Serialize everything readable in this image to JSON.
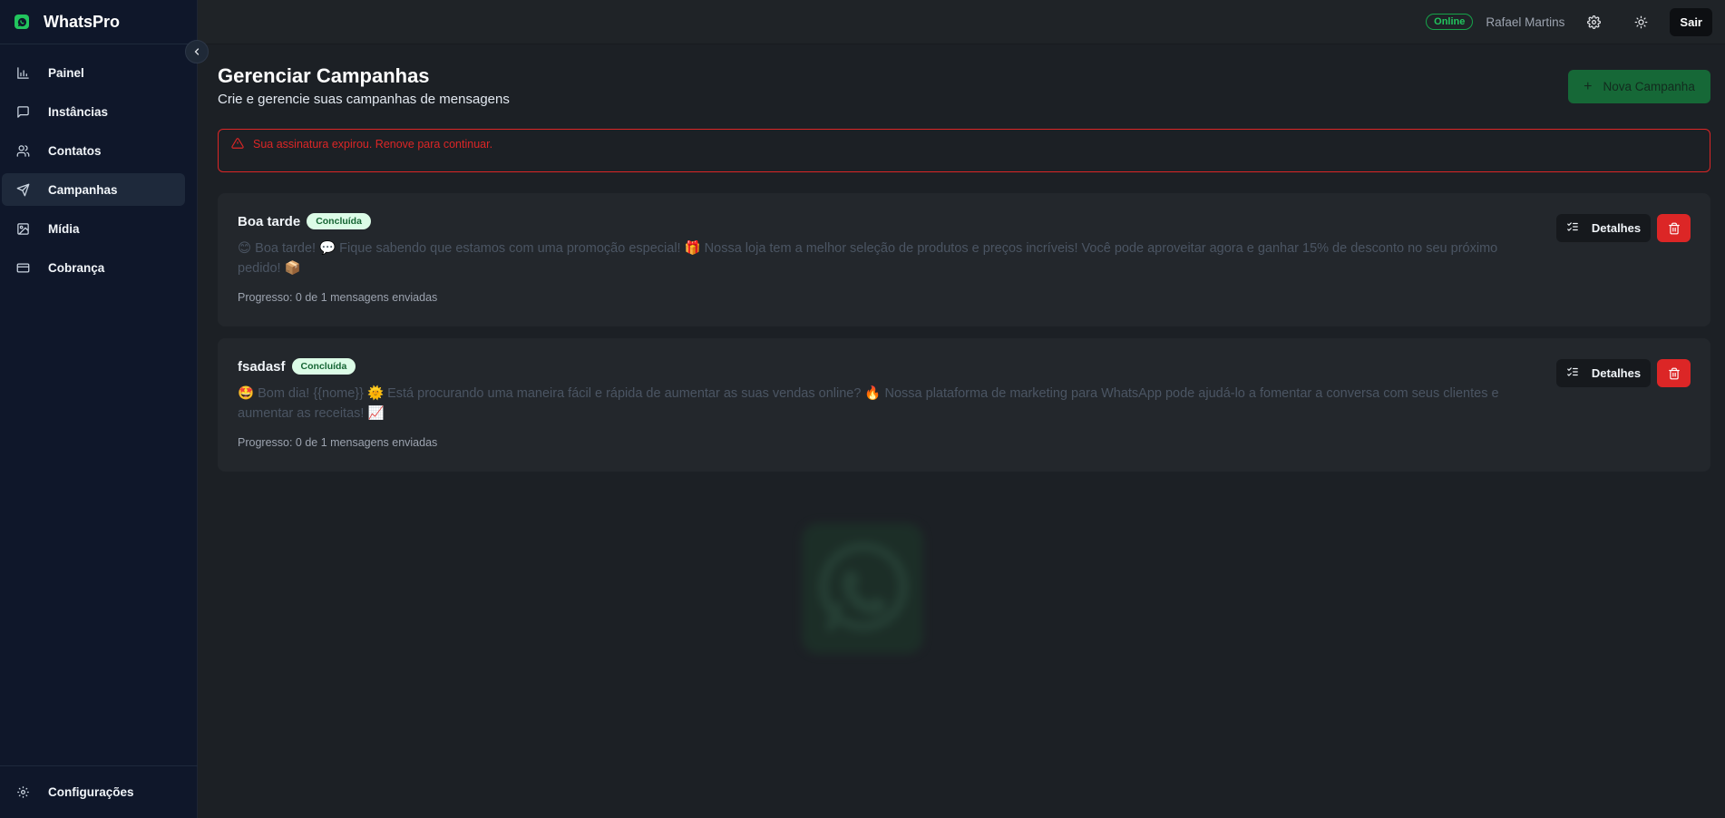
{
  "app": {
    "name": "WhatsPro",
    "logo_icon": "whatsapp-logo-icon"
  },
  "sidebar": {
    "items": [
      {
        "label": "Painel",
        "icon": "bar-chart-icon",
        "active": false
      },
      {
        "label": "Instâncias",
        "icon": "message-square-icon",
        "active": false
      },
      {
        "label": "Contatos",
        "icon": "users-icon",
        "active": false
      },
      {
        "label": "Campanhas",
        "icon": "send-icon",
        "active": true
      },
      {
        "label": "Mídia",
        "icon": "image-icon",
        "active": false
      },
      {
        "label": "Cobrança",
        "icon": "credit-card-icon",
        "active": false
      }
    ],
    "bottom_item": {
      "label": "Configurações",
      "icon": "settings-icon"
    }
  },
  "header": {
    "status": "Online",
    "user_name": "Rafael Martins",
    "logout_label": "Sair"
  },
  "page": {
    "title": "Gerenciar Campanhas",
    "subtitle": "Crie e gerencie suas campanhas de mensagens",
    "new_button_label": "Nova Campanha",
    "alert": "Sua assinatura expirou. Renove para continuar."
  },
  "campaigns": [
    {
      "name": "Boa tarde",
      "status": "Concluída",
      "message": "😊 Boa tarde! 💬 Fique sabendo que estamos com uma promoção especial! 🎁 Nossa loja tem a melhor seleção de produtos e preços incríveis! Você pode aproveitar agora e ganhar 15% de desconto no seu próximo pedido! 📦",
      "progress": "Progresso: 0 de 1 mensagens enviadas",
      "details_label": "Detalhes"
    },
    {
      "name": "fsadasf",
      "status": "Concluída",
      "message": "🤩 Bom dia! {{nome}} 🌞 Está procurando uma maneira fácil e rápida de aumentar as suas vendas online? 🔥 Nossa plataforma de marketing para WhatsApp pode ajudá-lo a fomentar a conversa com seus clientes e aumentar as receitas! 📈",
      "progress": "Progresso: 0 de 1 mensagens enviadas",
      "details_label": "Detalhes"
    }
  ],
  "colors": {
    "accent": "#15803d",
    "danger": "#dc2626",
    "sidebar_bg": "#0f172a",
    "main_bg": "#1c2025"
  }
}
